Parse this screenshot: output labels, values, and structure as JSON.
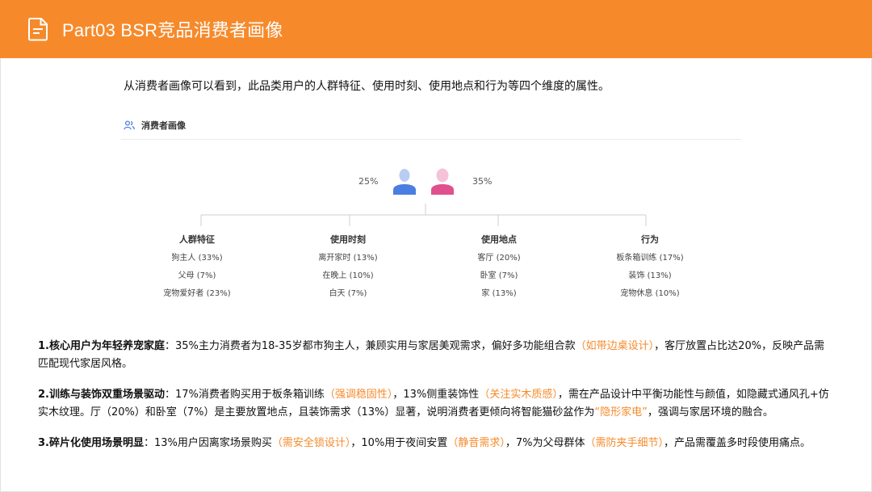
{
  "header": {
    "title": "Part03 BSR竞品消费者画像",
    "bg_color": "#f68a2b",
    "icon": "document-icon"
  },
  "intro": "从消费者画像可以看到，此品类用户的人群特征、使用时刻、使用地点和行为等四个维度的属性。",
  "panel": {
    "title": "消费者画像",
    "icon": "users-icon",
    "gender": {
      "male_pct": "25%",
      "female_pct": "35%",
      "male_color": "#4a7ee0",
      "female_color": "#e0508e"
    },
    "columns": [
      {
        "heading": "人群特征",
        "items": [
          "狗主人 (33%)",
          "父母 (7%)",
          "宠物爱好者 (23%)"
        ]
      },
      {
        "heading": "使用时刻",
        "items": [
          "离开家时 (13%)",
          "在晚上 (10%)",
          "白天 (7%)"
        ]
      },
      {
        "heading": "使用地点",
        "items": [
          "客厅 (20%)",
          "卧室 (7%)",
          "家 (13%)"
        ]
      },
      {
        "heading": "行为",
        "items": [
          "板条箱训练 (17%)",
          "装饰 (13%)",
          "宠物休息 (10%)"
        ]
      }
    ]
  },
  "findings": [
    {
      "parts": [
        {
          "text": "1.核心用户为年轻养宠家庭",
          "style": "bold"
        },
        {
          "text": "：35%主力消费者为18-35岁都市狗主人，兼顾实用与家居美观需求，偏好多功能组合款",
          "style": "normal"
        },
        {
          "text": "（如带边桌设计）",
          "style": "highlight"
        },
        {
          "text": "，客厅放置占比达20%，反映产品需匹配现代家居风格。",
          "style": "normal"
        }
      ]
    },
    {
      "parts": [
        {
          "text": "2.训练与装饰双重场景驱动",
          "style": "bold"
        },
        {
          "text": "：17%消费者购买用于板条箱训练",
          "style": "normal"
        },
        {
          "text": "（强调稳固性）",
          "style": "highlight"
        },
        {
          "text": "，13%侧重装饰性",
          "style": "normal"
        },
        {
          "text": "（关注实木质感）",
          "style": "highlight"
        },
        {
          "text": "，需在产品设计中平衡功能性与颜值，如隐藏式通风孔+仿实木纹理。厅（20%）和卧室（7%）是主要放置地点，且装饰需求（13%）显著，说明消费者更倾向将智能猫砂盆作为",
          "style": "normal"
        },
        {
          "text": "“隐形家电”",
          "style": "highlight"
        },
        {
          "text": "，强调与家居环境的融合。",
          "style": "normal"
        }
      ]
    },
    {
      "parts": [
        {
          "text": "3.碎片化使用场景明显",
          "style": "bold"
        },
        {
          "text": "：13%用户因离家场景购买",
          "style": "normal"
        },
        {
          "text": "（需安全锁设计）",
          "style": "highlight"
        },
        {
          "text": "，10%用于夜间安置",
          "style": "normal"
        },
        {
          "text": "（静音需求）",
          "style": "highlight"
        },
        {
          "text": "，7%为父母群体",
          "style": "normal"
        },
        {
          "text": "（需防夹手细节）",
          "style": "highlight"
        },
        {
          "text": "，产品需覆盖多时段使用痛点。",
          "style": "normal"
        }
      ]
    }
  ]
}
